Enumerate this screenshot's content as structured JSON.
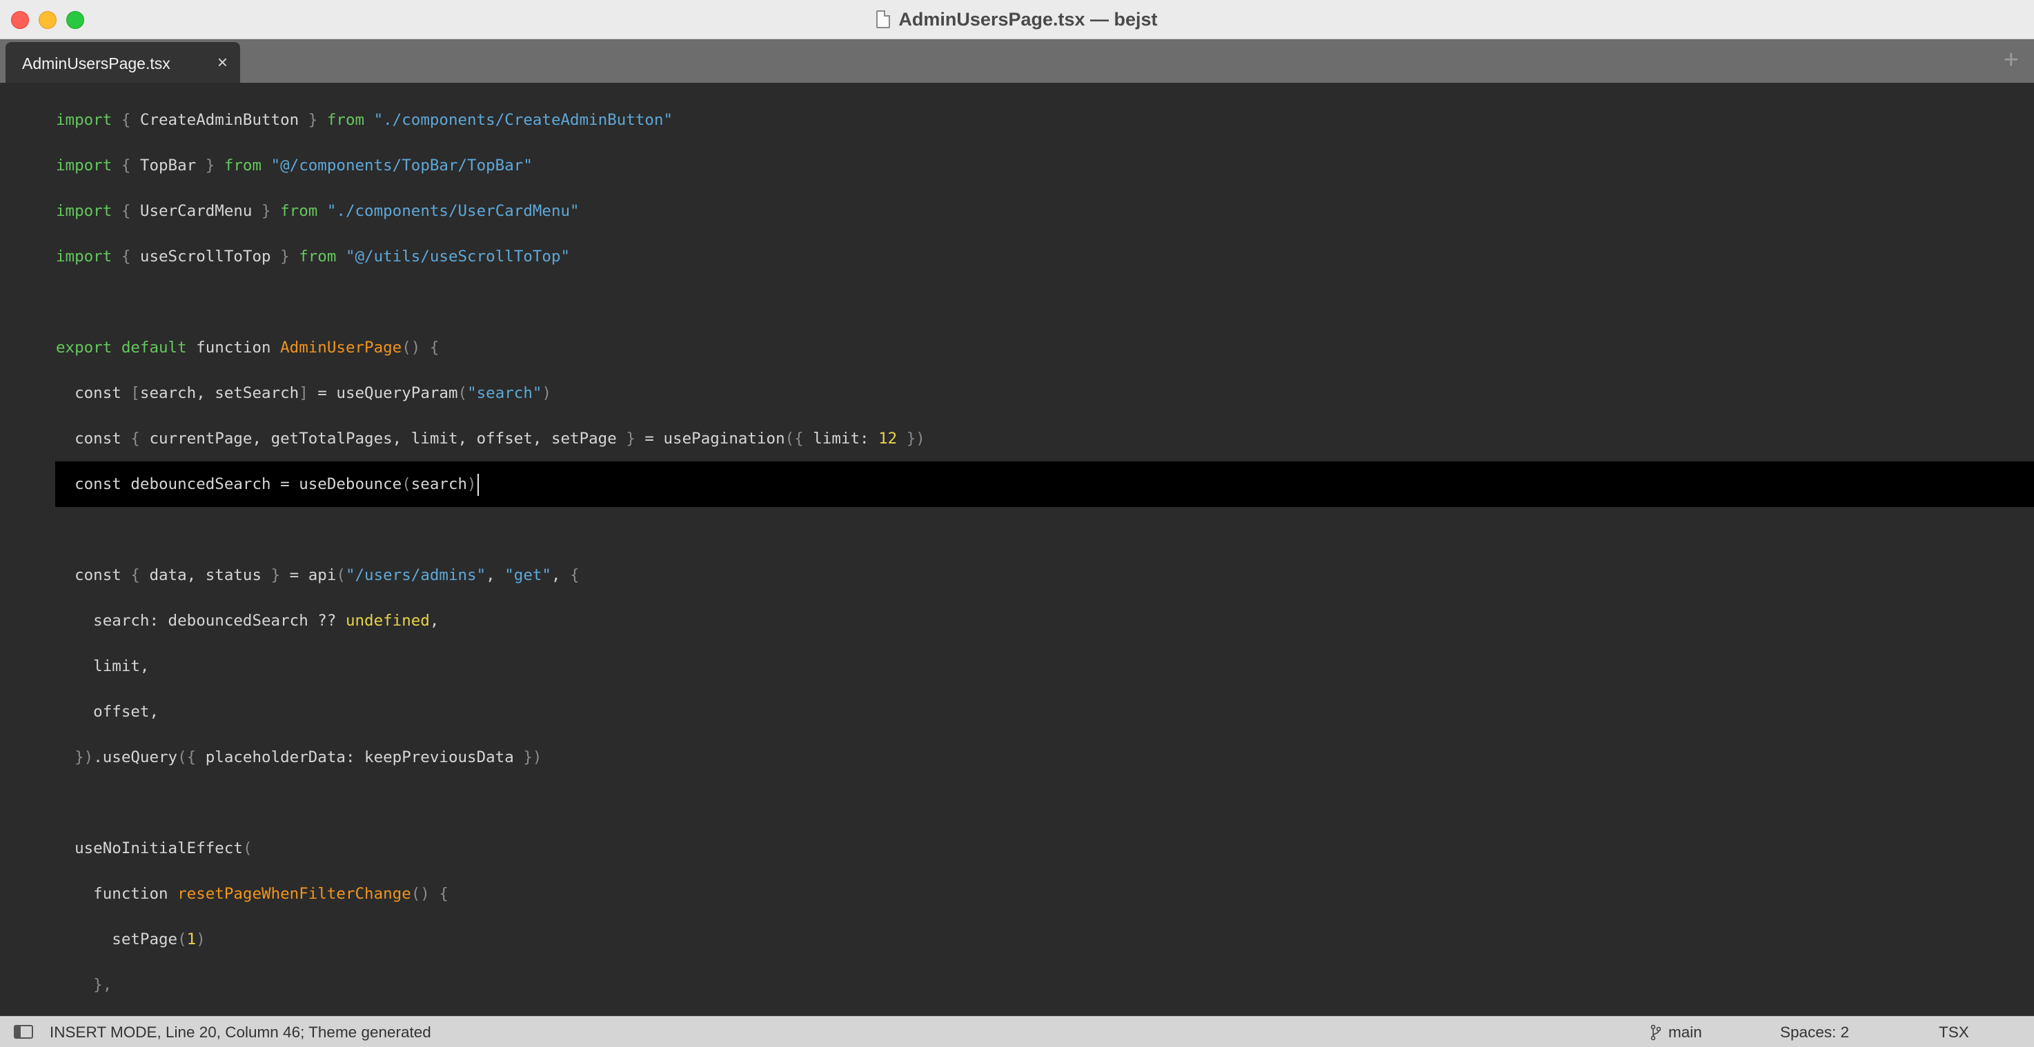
{
  "window": {
    "title": "AdminUsersPage.tsx — bejst"
  },
  "tabs": [
    {
      "label": "AdminUsersPage.tsx",
      "close": "×"
    }
  ],
  "tabbar": {
    "add_label": "+"
  },
  "editor": {
    "lines": [
      [
        [
          "kw",
          "import"
        ],
        [
          "brk",
          " { "
        ],
        [
          "",
          "CreateAdminButton"
        ],
        [
          "brk",
          " } "
        ],
        [
          "kw",
          "from"
        ],
        [
          "str",
          " \"./components/CreateAdminButton\""
        ]
      ],
      [
        [
          "kw",
          "import"
        ],
        [
          "brk",
          " { "
        ],
        [
          "",
          "TopBar"
        ],
        [
          "brk",
          " } "
        ],
        [
          "kw",
          "from"
        ],
        [
          "str",
          " \"@/components/TopBar/TopBar\""
        ]
      ],
      [
        [
          "kw",
          "import"
        ],
        [
          "brk",
          " { "
        ],
        [
          "",
          "UserCardMenu"
        ],
        [
          "brk",
          " } "
        ],
        [
          "kw",
          "from"
        ],
        [
          "str",
          " \"./components/UserCardMenu\""
        ]
      ],
      [
        [
          "kw",
          "import"
        ],
        [
          "brk",
          " { "
        ],
        [
          "",
          "useScrollToTop"
        ],
        [
          "brk",
          " } "
        ],
        [
          "kw",
          "from"
        ],
        [
          "str",
          " \"@/utils/useScrollToTop\""
        ]
      ],
      [],
      [
        [
          "kw",
          "export default"
        ],
        [
          "",
          " function "
        ],
        [
          "fn",
          "AdminUserPage"
        ],
        [
          "brk",
          "() {"
        ]
      ],
      [
        [
          "",
          "  const "
        ],
        [
          "brk",
          "["
        ],
        [
          "",
          "search, setSearch"
        ],
        [
          "brk",
          "]"
        ],
        [
          "",
          " = useQueryParam"
        ],
        [
          "brk",
          "("
        ],
        [
          "str",
          "\"search\""
        ],
        [
          "brk",
          ")"
        ]
      ],
      [
        [
          "",
          "  const "
        ],
        [
          "brk",
          "{ "
        ],
        [
          "",
          "currentPage, getTotalPages, limit, offset, setPage "
        ],
        [
          "brk",
          "}"
        ],
        [
          "",
          " = usePagination"
        ],
        [
          "brk",
          "({ "
        ],
        [
          "",
          "limit: "
        ],
        [
          "num",
          "12"
        ],
        [
          "brk",
          " })"
        ]
      ],
      [
        [
          "",
          "  const debouncedSearch = useDebounce"
        ],
        [
          "brk",
          "("
        ],
        [
          "",
          "search"
        ],
        [
          "brk",
          ")"
        ]
      ],
      [],
      [
        [
          "",
          "  const "
        ],
        [
          "brk",
          "{ "
        ],
        [
          "",
          "data, status "
        ],
        [
          "brk",
          "}"
        ],
        [
          "",
          " = api"
        ],
        [
          "brk",
          "("
        ],
        [
          "str",
          "\"/users/admins\""
        ],
        [
          "",
          ", "
        ],
        [
          "str",
          "\"get\""
        ],
        [
          "",
          ", "
        ],
        [
          "brk",
          "{"
        ]
      ],
      [
        [
          "",
          "    search: debouncedSearch ?? "
        ],
        [
          "num",
          "undefined"
        ],
        [
          "",
          ","
        ]
      ],
      [
        [
          "",
          "    limit,"
        ]
      ],
      [
        [
          "",
          "    offset,"
        ]
      ],
      [
        [
          "brk",
          "  })"
        ],
        [
          "",
          ".useQuery"
        ],
        [
          "brk",
          "({ "
        ],
        [
          "",
          "placeholderData: keepPreviousData "
        ],
        [
          "brk",
          "})"
        ]
      ],
      [],
      [
        [
          "",
          "  useNoInitialEffect"
        ],
        [
          "brk",
          "("
        ]
      ],
      [
        [
          "",
          "    function "
        ],
        [
          "fn",
          "resetPageWhenFilterChange"
        ],
        [
          "brk",
          "() {"
        ]
      ],
      [
        [
          "",
          "      setPage"
        ],
        [
          "brk",
          "("
        ],
        [
          "num",
          "1"
        ],
        [
          "brk",
          ")"
        ]
      ],
      [
        [
          "brk",
          "    },"
        ]
      ]
    ],
    "current_line_index": 8
  },
  "statusbar": {
    "message": "INSERT MODE, Line 20, Column 46; Theme generated",
    "branch": "main",
    "spaces": "Spaces: 2",
    "syntax": "TSX"
  }
}
